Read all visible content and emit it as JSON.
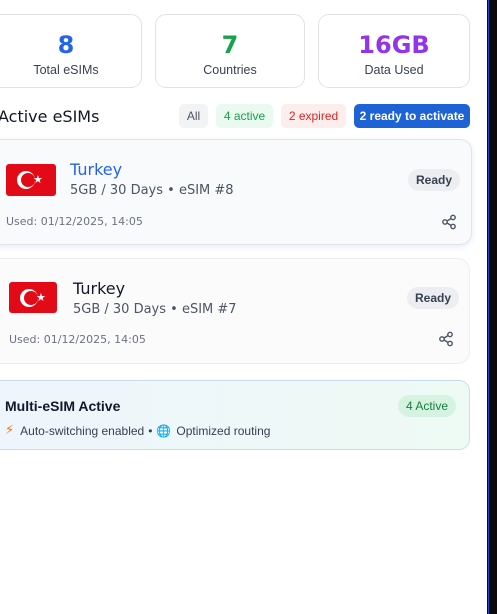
{
  "stats": [
    {
      "value": "8",
      "label": "Total eSIMs",
      "color": "#2563eb"
    },
    {
      "value": "7",
      "label": "Countries",
      "color": "#16a34a"
    },
    {
      "value": "16GB",
      "label": "Data Used",
      "color": "#9333ea"
    }
  ],
  "section": {
    "title": "Active eSIMs"
  },
  "filters": {
    "all": "All",
    "active": "4 active",
    "expired": "2 expired",
    "ready": "2 ready to activate"
  },
  "esims": [
    {
      "country": "Turkey",
      "plan": "5GB / 30 Days • eSIM #8",
      "status": "Ready",
      "used": "Used: 01/12/2025, 14:05",
      "country_color": "#2563eb",
      "flag_icon": "turkey-flag"
    },
    {
      "country": "Turkey",
      "plan": "5GB / 30 Days • eSIM #7",
      "status": "Ready",
      "used": "Used: 01/12/2025, 14:05",
      "country_color": "#111827",
      "flag_icon": "turkey-flag"
    }
  ],
  "multi": {
    "title": "Multi-eSIM Active",
    "badge": "4 Active",
    "auto": "Auto-switching enabled",
    "separator": "•",
    "routing": "Optimized routing"
  }
}
